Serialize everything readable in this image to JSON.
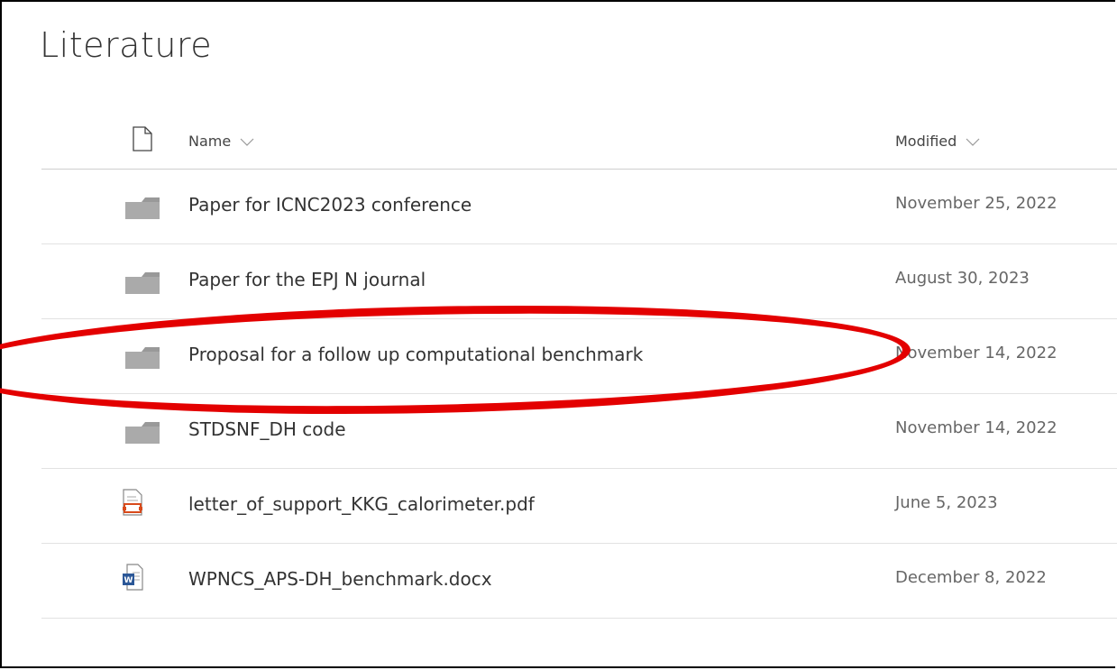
{
  "library": {
    "title": "Literature"
  },
  "columns": {
    "name_label": "Name",
    "modified_label": "Modified"
  },
  "files": [
    {
      "name": "Paper for ICNC2023 conference",
      "modified": "November 25, 2022",
      "type": "folder"
    },
    {
      "name": "Paper for the EPJ N journal",
      "modified": "August 30, 2023",
      "type": "folder"
    },
    {
      "name": "Proposal for a follow up computational benchmark",
      "modified": "November 14, 2022",
      "type": "folder"
    },
    {
      "name": "STDSNF_DH code",
      "modified": "November 14, 2022",
      "type": "folder"
    },
    {
      "name": "letter_of_support_KKG_calorimeter.pdf",
      "modified": "June 5, 2023",
      "type": "pdf"
    },
    {
      "name": "WPNCS_APS-DH_benchmark.docx",
      "modified": "December 8, 2022",
      "type": "docx"
    }
  ],
  "annotation": {
    "color": "#e30000",
    "highlighted_row": 2
  }
}
